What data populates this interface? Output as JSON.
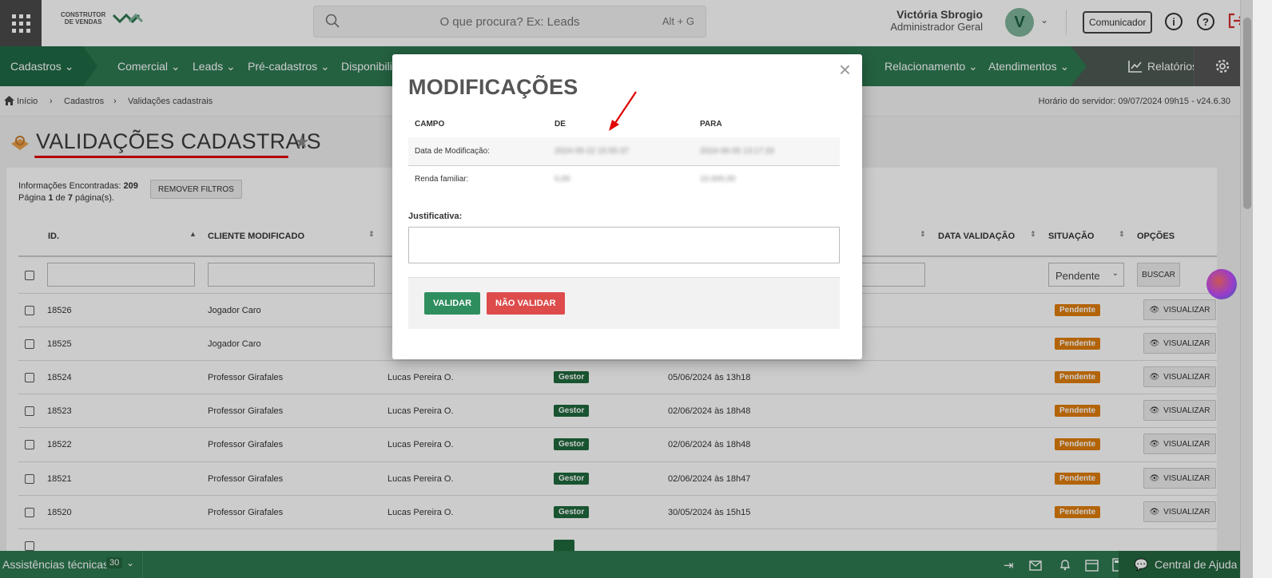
{
  "header": {
    "logo_line1": "CONSTRUTOR",
    "logo_line2": "DE VENDAS",
    "search_placeholder": "O que procura? Ex: Leads",
    "search_shortcut": "Alt + G",
    "user_name": "Victória Sbrogio",
    "user_role": "Administrador Geral",
    "avatar_letter": "V",
    "comunicador": "Comunicador"
  },
  "nav": {
    "items": [
      {
        "label": "Cadastros ⌄"
      },
      {
        "label": "Comercial ⌄"
      },
      {
        "label": "Leads ⌄"
      },
      {
        "label": "Pré-cadastros ⌄"
      },
      {
        "label": "Disponibili"
      },
      {
        "label": "Relacionamento ⌄"
      },
      {
        "label": "Atendimentos ⌄"
      },
      {
        "label": "Relatórios"
      }
    ]
  },
  "breadcrumb": {
    "items": [
      "Início",
      "Cadastros",
      "Validações cadastrais"
    ],
    "server_time": "Horário do servidor: 09/07/2024 09h15 - v24.6.30"
  },
  "page": {
    "title": "VALIDAÇÕES CADASTRAIS",
    "info_found_label": "Informações Encontradas:",
    "info_found_count": "209",
    "info_page_prefix": "Página",
    "info_page_current": "1",
    "info_page_of": "de",
    "info_page_total": "7",
    "info_page_suffix": "página(s).",
    "remove_filters": "REMOVER FILTROS"
  },
  "table": {
    "columns": {
      "id": "ID.",
      "client": "CLIENTE MODIFICADO",
      "validation_date": "DATA VALIDAÇÃO",
      "status": "SITUAÇÃO",
      "options": "OPÇÕES"
    },
    "status_filter": "Pendente",
    "search_button": "BUSCAR",
    "view_label": "VISUALIZAR",
    "rows": [
      {
        "id": "18526",
        "client": "Jogador Caro",
        "user": "",
        "role": "",
        "date": "",
        "status": "Pendente"
      },
      {
        "id": "18525",
        "client": "Jogador Caro",
        "user": "",
        "role": "",
        "date": "",
        "status": "Pendente"
      },
      {
        "id": "18524",
        "client": "Professor Girafales",
        "user": "Lucas Pereira O.",
        "role": "Gestor",
        "date": "05/06/2024 às 13h18",
        "status": "Pendente"
      },
      {
        "id": "18523",
        "client": "Professor Girafales",
        "user": "Lucas Pereira O.",
        "role": "Gestor",
        "date": "02/06/2024 às 18h48",
        "status": "Pendente"
      },
      {
        "id": "18522",
        "client": "Professor Girafales",
        "user": "Lucas Pereira O.",
        "role": "Gestor",
        "date": "02/06/2024 às 18h48",
        "status": "Pendente"
      },
      {
        "id": "18521",
        "client": "Professor Girafales",
        "user": "Lucas Pereira O.",
        "role": "Gestor",
        "date": "02/06/2024 às 18h47",
        "status": "Pendente"
      },
      {
        "id": "18520",
        "client": "Professor Girafales",
        "user": "Lucas Pereira O.",
        "role": "Gestor",
        "date": "30/05/2024 às 15h15",
        "status": "Pendente"
      }
    ]
  },
  "footer": {
    "left_label": "Assistências técnicas",
    "count": "30",
    "help": "Central de Ajuda"
  },
  "modal": {
    "title": "MODIFICAÇÕES",
    "col_field": "CAMPO",
    "col_from": "DE",
    "col_to": "PARA",
    "rows": [
      {
        "field": "Data de Modificação:",
        "from": "2024-05-22 15:55:37",
        "to": "2024-06-05 13:17:33"
      },
      {
        "field": "Renda familiar:",
        "from": "0,00",
        "to": "10.000,00"
      }
    ],
    "justification_label": "Justificativa:",
    "validate": "VALIDAR",
    "not_validate": "NÃO VALIDAR"
  },
  "colors": {
    "nav_green": "#2d7a52",
    "badge_pending": "#e07d0c",
    "badge_gestor": "#1f6a3c",
    "validate_btn": "#2f8e5e",
    "not_validate_btn": "#dd4b4b",
    "annotation_red": "#e00000"
  }
}
